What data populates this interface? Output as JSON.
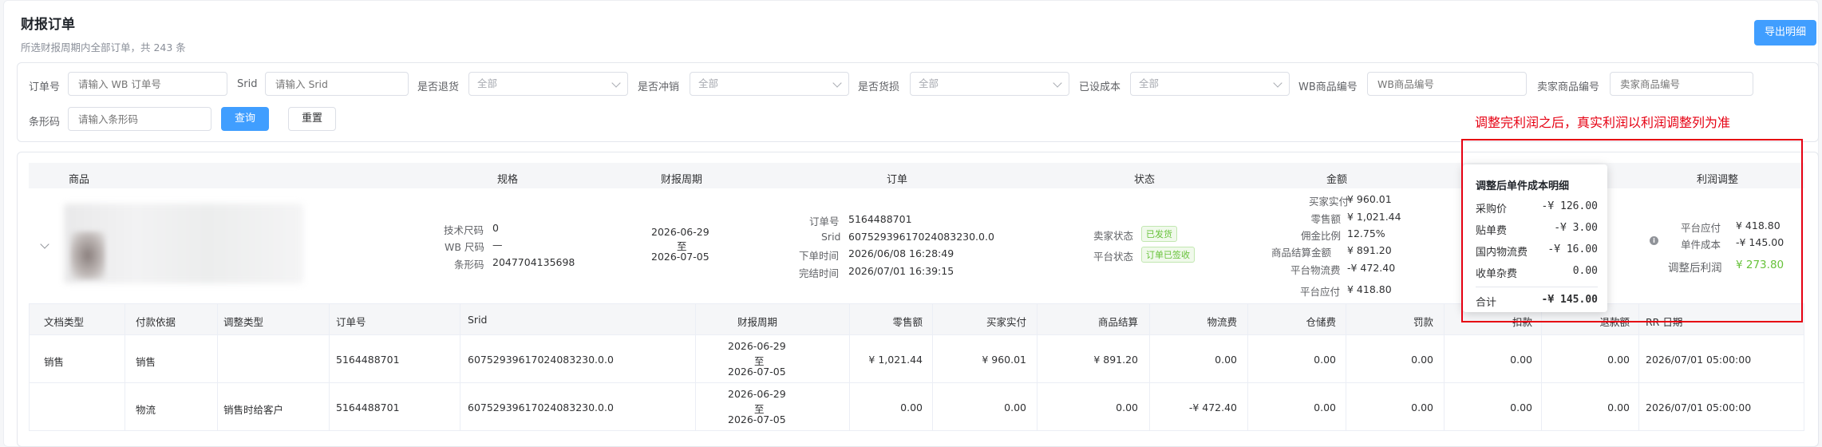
{
  "header": {
    "title": "财报订单",
    "subtitle": "所选财报周期内全部订单，共 243 条",
    "export_label": "导出明细"
  },
  "filters": {
    "order_no": {
      "label": "订单号",
      "placeholder": "请输入 WB 订单号"
    },
    "srid": {
      "label": "Srid",
      "placeholder": "请输入 Srid"
    },
    "is_return": {
      "label": "是否退货",
      "value": "全部"
    },
    "is_reversal": {
      "label": "是否冲销",
      "value": "全部"
    },
    "is_damage": {
      "label": "是否货损",
      "value": "全部"
    },
    "has_cost": {
      "label": "已设成本",
      "value": "全部"
    },
    "wb_sku": {
      "label": "WB商品编号",
      "placeholder": "WB商品编号"
    },
    "seller_sku": {
      "label": "卖家商品编号",
      "placeholder": "卖家商品编号"
    },
    "barcode": {
      "label": "条形码",
      "placeholder": "请输入条形码"
    },
    "query_label": "查询",
    "reset_label": "重置"
  },
  "annotation": "调整完利润之后，真实利润以利润调整列为准",
  "table": {
    "headers": {
      "product": "商品",
      "spec": "规格",
      "period": "财报周期",
      "order": "订单",
      "status": "状态",
      "amount": "金额",
      "profit_adj": "利润调整"
    },
    "row": {
      "spec": {
        "tech_size_k": "技术尺码",
        "tech_size_v": "0",
        "wb_size_k": "WB 尺码",
        "wb_size_v": "—",
        "barcode_k": "条形码",
        "barcode_v": "2047704135698"
      },
      "period": {
        "start": "2026-06-29",
        "to": "至",
        "end": "2026-07-05"
      },
      "order": {
        "no_k": "订单号",
        "no_v": "5164488701",
        "srid_k": "Srid",
        "srid_v": "60752939617024083230.0.0",
        "created_k": "下单时间",
        "created_v": "2026/06/08 16:28:49",
        "done_k": "完结时间",
        "done_v": "2026/07/01 16:39:15"
      },
      "status": {
        "seller_k": "卖家状态",
        "seller_v": "已发货",
        "platform_k": "平台状态",
        "platform_v": "订单已签收"
      },
      "amount": {
        "buyer_paid_k": "买家实付",
        "buyer_paid_v": "¥ 960.01",
        "retail_k": "零售额",
        "retail_v": "¥ 1,021.44",
        "commission_k": "佣金比例",
        "commission_v": "12.75%",
        "settle_k": "商品结算金额",
        "settle_v": "¥ 891.20",
        "logistics_k": "平台物流费",
        "logistics_v": "-¥ 472.40",
        "payable_k": "平台应付",
        "payable_v": "¥ 418.80"
      },
      "profit": {
        "payable_k": "平台应付",
        "payable_v": "¥ 418.80",
        "unit_cost_k": "单件成本",
        "unit_cost_v": "-¥ 145.00",
        "adjusted_k": "调整后利润",
        "adjusted_v": "¥ 273.80"
      }
    }
  },
  "tooltip": {
    "title": "调整后单件成本明细",
    "rows": [
      {
        "k": "采购价",
        "v": "-¥ 126.00"
      },
      {
        "k": "贴单费",
        "v": "-¥ 3.00"
      },
      {
        "k": "国内物流费",
        "v": "-¥ 16.00"
      },
      {
        "k": "收单杂费",
        "v": "0.00"
      }
    ],
    "total_k": "合计",
    "total_v": "-¥ 145.00"
  },
  "detail": {
    "headers": [
      "文档类型",
      "付款依据",
      "调整类型",
      "订单号",
      "Srid",
      "财报周期",
      "零售额",
      "买家实付",
      "商品结算",
      "物流费",
      "仓储费",
      "罚款",
      "扣款",
      "退款额",
      "RR 日期"
    ],
    "rows": [
      {
        "doc": "销售",
        "basis": "销售",
        "adj": "",
        "order": "5164488701",
        "srid": "60752939617024083230.0.0",
        "p1": "2026-06-29",
        "p2": "至",
        "p3": "2026-07-05",
        "retail": "¥ 1,021.44",
        "paid": "¥ 960.01",
        "settle": "¥ 891.20",
        "logistics": "0.00",
        "storage": "0.00",
        "fine": "0.00",
        "deduct": "0.00",
        "refund": "0.00",
        "rr": "2026/07/01 05:00:00"
      },
      {
        "doc": "",
        "basis": "物流",
        "adj": "销售时给客户",
        "order": "5164488701",
        "srid": "60752939617024083230.0.0",
        "p1": "2026-06-29",
        "p2": "至",
        "p3": "2026-07-05",
        "retail": "0.00",
        "paid": "0.00",
        "settle": "0.00",
        "logistics": "-¥ 472.40",
        "storage": "0.00",
        "fine": "0.00",
        "deduct": "0.00",
        "refund": "0.00",
        "rr": "2026/07/01 05:00:00"
      }
    ]
  },
  "colors": {
    "primary": "#409eff",
    "success": "#67c23a",
    "annotation": "#e60012"
  }
}
